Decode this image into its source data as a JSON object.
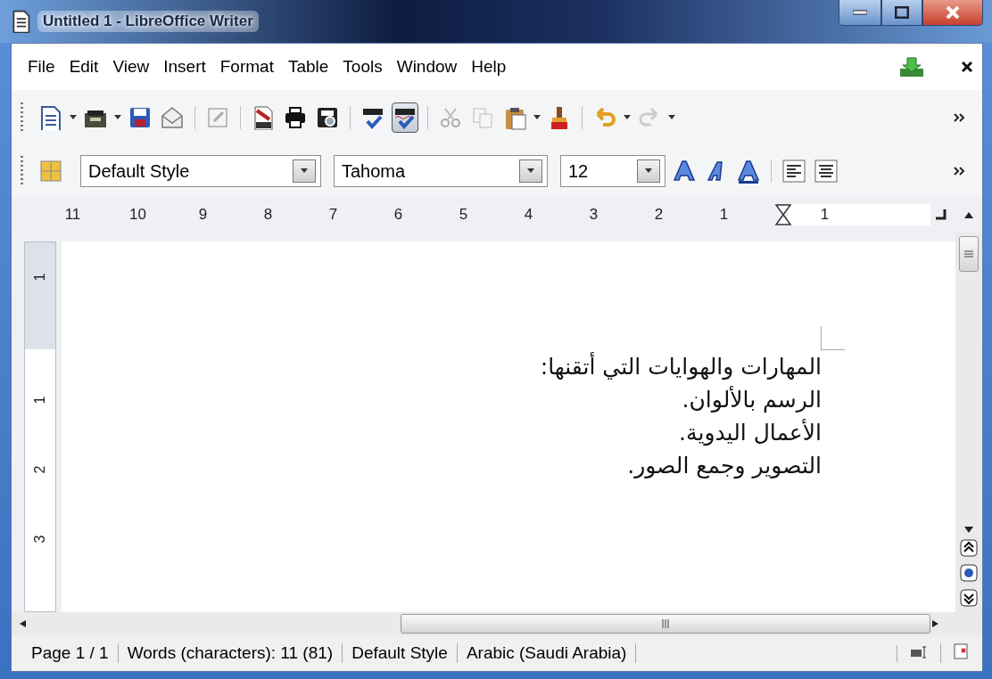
{
  "window": {
    "title": "Untitled 1 - LibreOffice Writer"
  },
  "menu": [
    "File",
    "Edit",
    "View",
    "Insert",
    "Format",
    "Table",
    "Tools",
    "Window",
    "Help"
  ],
  "standard_toolbar": {
    "autospellcheck_pressed": true
  },
  "formatting_toolbar": {
    "paragraph_style": "Default Style",
    "font_name": "Tahoma",
    "font_size": "12"
  },
  "ruler": {
    "left_labels": [
      "11",
      "10",
      "9",
      "8",
      "7",
      "6",
      "5",
      "4",
      "3",
      "2",
      "1"
    ],
    "right_labels": [
      "1"
    ]
  },
  "vertical_ruler": [
    "1",
    "1",
    "2",
    "3"
  ],
  "document": {
    "lines": [
      "المهارات والهوايات التي أتقنها:",
      "الرسم بالألوان.",
      "الأعمال اليدوية.",
      "التصوير وجمع الصور."
    ]
  },
  "status_bar": [
    "Page 1 / 1",
    "Words (characters): 11 (81)",
    "Default Style",
    "Arabic (Saudi Arabia)"
  ]
}
